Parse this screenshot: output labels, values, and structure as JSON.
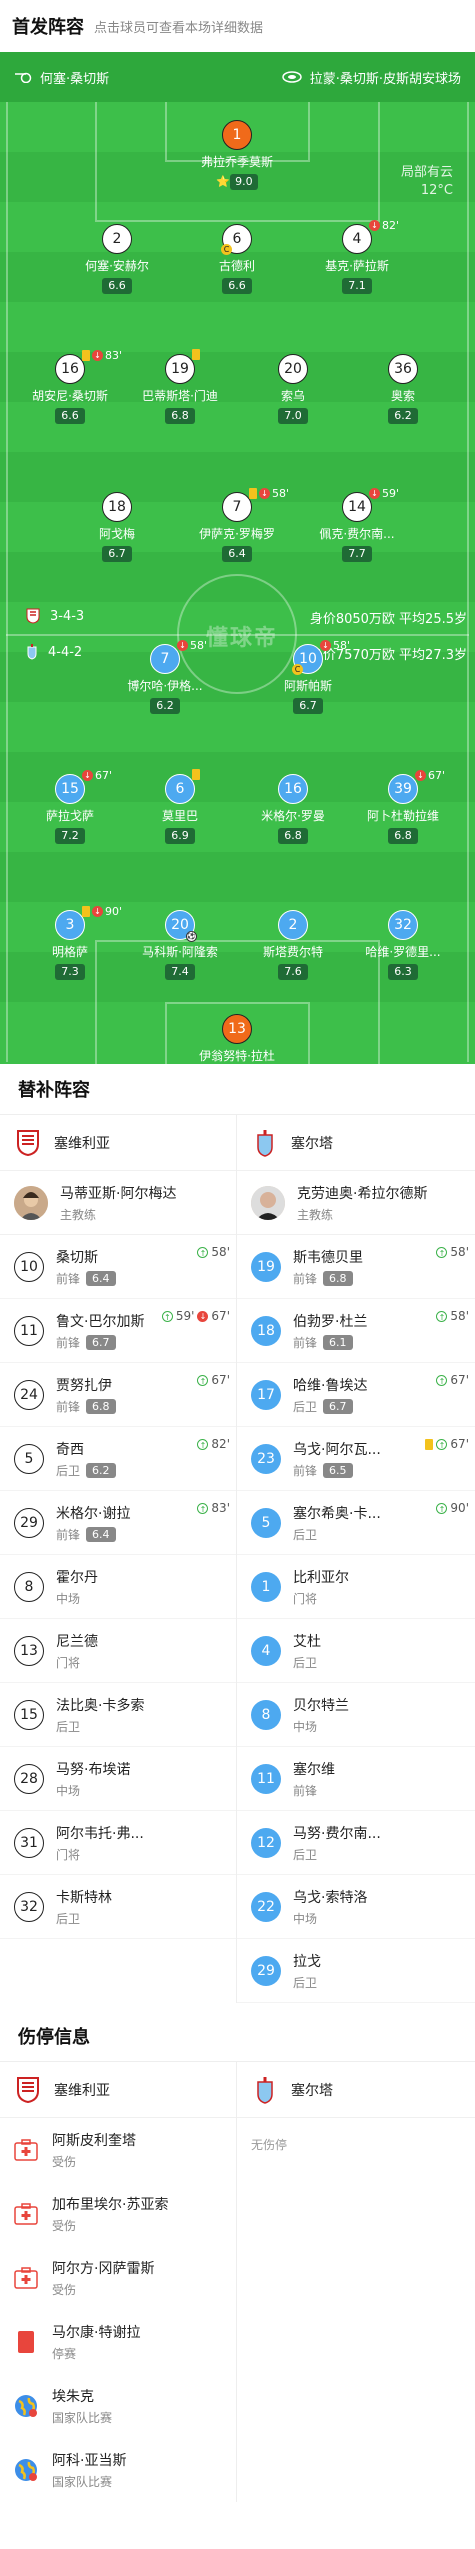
{
  "header": {
    "title": "首发阵容",
    "subtitle": "点击球员可查看本场详细数据"
  },
  "teams": {
    "home": "何塞·桑切斯",
    "away": "拉蒙·桑切斯·皮斯胡安球场"
  },
  "weather": {
    "condition": "局部有云",
    "temp": "12°C"
  },
  "watermark": "懂球帝",
  "home_info": {
    "formation": "3-4-3",
    "stats": "身价8050万欧 平均25.5岁"
  },
  "away_info": {
    "formation": "4-4-2",
    "stats": "身价7570万欧 平均27.3岁"
  },
  "home_players": [
    {
      "num": "1",
      "name": "弗拉乔季莫斯",
      "rating": "9.0",
      "star": true,
      "gk": true
    },
    {
      "num": "2",
      "name": "何塞·安赫尔",
      "rating": "6.6"
    },
    {
      "num": "6",
      "name": "古德利",
      "rating": "6.6",
      "captain": true
    },
    {
      "num": "4",
      "name": "基克·萨拉斯",
      "rating": "7.1",
      "sub": "82'"
    },
    {
      "num": "16",
      "name": "胡安尼·桑切斯",
      "rating": "6.6",
      "sub": "83'",
      "yellow": true
    },
    {
      "num": "19",
      "name": "巴蒂斯塔·门迪",
      "rating": "6.8",
      "yellow": true
    },
    {
      "num": "20",
      "name": "索乌",
      "rating": "7.0"
    },
    {
      "num": "36",
      "name": "奥索",
      "rating": "6.2"
    },
    {
      "num": "18",
      "name": "阿戈梅",
      "rating": "6.7"
    },
    {
      "num": "7",
      "name": "伊萨克·罗梅罗",
      "rating": "6.4",
      "sub": "58'",
      "yellow": true
    },
    {
      "num": "14",
      "name": "佩克·费尔南...",
      "rating": "7.7",
      "sub": "59'"
    }
  ],
  "away_players": [
    {
      "num": "7",
      "name": "博尔哈·伊格...",
      "rating": "6.2",
      "sub": "58'"
    },
    {
      "num": "10",
      "name": "阿斯帕斯",
      "rating": "6.7",
      "sub": "58'",
      "captain": true
    },
    {
      "num": "15",
      "name": "萨拉戈萨",
      "rating": "7.2",
      "sub": "67'"
    },
    {
      "num": "6",
      "name": "莫里巴",
      "rating": "6.9",
      "yellow": true
    },
    {
      "num": "16",
      "name": "米格尔·罗曼",
      "rating": "6.8"
    },
    {
      "num": "39",
      "name": "阿卜杜勒拉维",
      "rating": "6.8",
      "sub": "67'"
    },
    {
      "num": "3",
      "name": "明格萨",
      "rating": "7.3",
      "sub": "90'",
      "yellow": true
    },
    {
      "num": "20",
      "name": "马科斯·阿隆索",
      "rating": "7.4",
      "goal": true
    },
    {
      "num": "2",
      "name": "斯塔费尔特",
      "rating": "7.6"
    },
    {
      "num": "32",
      "name": "哈维·罗德里...",
      "rating": "6.3"
    },
    {
      "num": "13",
      "name": "伊翁努特·拉杜",
      "rating": "6.9",
      "gk": true
    }
  ],
  "subs_title": "替补阵容",
  "home_team_name": "塞维利亚",
  "away_team_name": "塞尔塔",
  "home_coach": {
    "name": "马蒂亚斯·阿尔梅达",
    "role": "主教练"
  },
  "away_coach": {
    "name": "克劳迪奥·希拉尔德斯",
    "role": "主教练"
  },
  "home_subs": [
    {
      "num": "10",
      "name": "桑切斯",
      "pos": "前锋",
      "rating": "6.4",
      "ev": "58'",
      "up": true
    },
    {
      "num": "11",
      "name": "鲁文·巴尔加斯",
      "pos": "前锋",
      "rating": "6.7",
      "ev": "59'",
      "ev2": "67'",
      "up": true,
      "down": true
    },
    {
      "num": "24",
      "name": "贾努扎伊",
      "pos": "前锋",
      "rating": "6.8",
      "ev": "67'",
      "up": true
    },
    {
      "num": "5",
      "name": "奇西",
      "pos": "后卫",
      "rating": "6.2",
      "ev": "82'",
      "up": true
    },
    {
      "num": "29",
      "name": "米格尔·谢拉",
      "pos": "前锋",
      "rating": "6.4",
      "ev": "83'",
      "up": true
    },
    {
      "num": "8",
      "name": "霍尔丹",
      "pos": "中场"
    },
    {
      "num": "13",
      "name": "尼兰德",
      "pos": "门将"
    },
    {
      "num": "15",
      "name": "法比奥·卡多索",
      "pos": "后卫"
    },
    {
      "num": "28",
      "name": "马努·布埃诺",
      "pos": "中场"
    },
    {
      "num": "31",
      "name": "阿尔韦托·弗...",
      "pos": "门将"
    },
    {
      "num": "32",
      "name": "卡斯特林",
      "pos": "后卫"
    }
  ],
  "away_subs": [
    {
      "num": "19",
      "name": "斯韦德贝里",
      "pos": "前锋",
      "rating": "6.8",
      "ev": "58'",
      "up": true
    },
    {
      "num": "18",
      "name": "伯勃罗·杜兰",
      "pos": "前锋",
      "rating": "6.1",
      "ev": "58'",
      "up": true
    },
    {
      "num": "17",
      "name": "哈维·鲁埃达",
      "pos": "后卫",
      "rating": "6.7",
      "ev": "67'",
      "up": true
    },
    {
      "num": "23",
      "name": "乌戈·阿尔瓦...",
      "pos": "前锋",
      "rating": "6.5",
      "ev": "67'",
      "up": true,
      "yellow": true
    },
    {
      "num": "5",
      "name": "塞尔希奥·卡...",
      "pos": "后卫",
      "ev": "90'",
      "up": true
    },
    {
      "num": "1",
      "name": "比利亚尔",
      "pos": "门将"
    },
    {
      "num": "4",
      "name": "艾杜",
      "pos": "后卫"
    },
    {
      "num": "8",
      "name": "贝尔特兰",
      "pos": "中场"
    },
    {
      "num": "11",
      "name": "塞尔维",
      "pos": "前锋"
    },
    {
      "num": "12",
      "name": "马努·费尔南...",
      "pos": "后卫"
    },
    {
      "num": "22",
      "name": "乌戈·索特洛",
      "pos": "中场"
    },
    {
      "num": "29",
      "name": "拉戈",
      "pos": "后卫"
    }
  ],
  "injury_title": "伤停信息",
  "home_injuries": [
    {
      "name": "阿斯皮利奎塔",
      "status": "受伤",
      "icon": "medkit-icon"
    },
    {
      "name": "加布里埃尔·苏亚索",
      "status": "受伤",
      "icon": "medkit-icon"
    },
    {
      "name": "阿尔方·冈萨雷斯",
      "status": "受伤",
      "icon": "medkit-icon"
    },
    {
      "name": "马尔康·特谢拉",
      "status": "停赛",
      "icon": "red-card-icon"
    },
    {
      "name": "埃朱克",
      "status": "国家队比赛",
      "icon": "globe-icon"
    },
    {
      "name": "阿科·亚当斯",
      "status": "国家队比赛",
      "icon": "globe-icon"
    }
  ],
  "away_injuries_text": "无伤停",
  "colors": {
    "pitch": "#3dbf4a",
    "gk": "#f06a1a",
    "away": "#4da9f0",
    "rating_bg": "#1f6b35"
  }
}
